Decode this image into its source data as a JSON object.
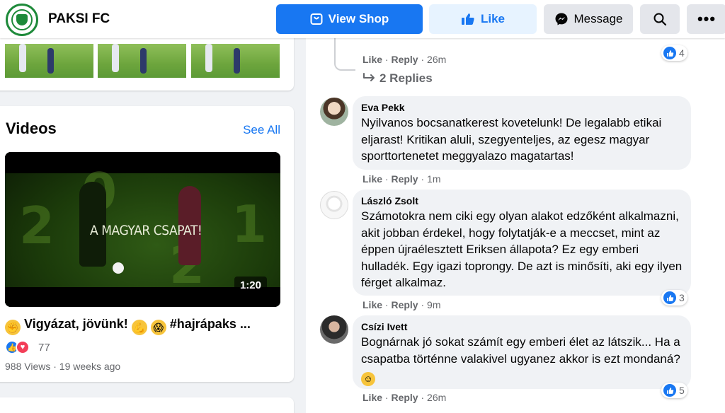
{
  "header": {
    "page_name": "PAKSI FC",
    "view_shop": "View Shop",
    "like": "Like",
    "message": "Message",
    "more": "•••"
  },
  "videos": {
    "title": "Videos",
    "see_all": "See All",
    "video": {
      "overlay_text": "A MAGYAR CSAPAT!",
      "overlay_numbers": [
        "2",
        "0",
        "2",
        "1"
      ],
      "duration": "1:20",
      "title_parts": [
        "Vigyázat, jövünk!",
        "#hajrápaks ..."
      ],
      "reaction_count": "77",
      "views": "988 Views",
      "age": "19 weeks ago",
      "separator": " · "
    }
  },
  "comments": {
    "top_actions": {
      "like": "Like",
      "reply": "Reply",
      "time": "26m",
      "reactions": "4"
    },
    "replies_label": "2 Replies",
    "items": [
      {
        "name": "Eva Pekk",
        "text": "Nyilvanos bocsanatkerest kovetelunk! De legalabb etikai eljarast! Kritikan aluli, szegyenteljes, az egesz magyar sporttortenetet meggyalazo magatartas!",
        "like": "Like",
        "reply": "Reply",
        "time": "1m"
      },
      {
        "name": "László Zsolt",
        "text": "Számotokra nem ciki egy olyan alakot edzőként alkalmazni, akit jobban érdekel, hogy folytatják-e a meccset, mint az éppen újraélesztett Eriksen állapota? Ez egy emberi hulladék. Egy igazi toprongy. De azt is minősíti, aki egy ilyen férget alkalmaz.",
        "like": "Like",
        "reply": "Reply",
        "time": "9m",
        "reactions": "3"
      },
      {
        "name": "Csízi Ivett",
        "text": "Bognárnak jó sokat számít egy emberi élet az látszik... Ha a csapatba történne valakivel ugyanez akkor is ezt mondaná?",
        "like": "Like",
        "reply": "Reply",
        "time": "26m",
        "reactions": "5"
      }
    ],
    "separator": " · "
  },
  "colors": {
    "accent": "#1877f2",
    "like_bg": "#e7f3ff",
    "brand_green": "#1e8a3a"
  }
}
